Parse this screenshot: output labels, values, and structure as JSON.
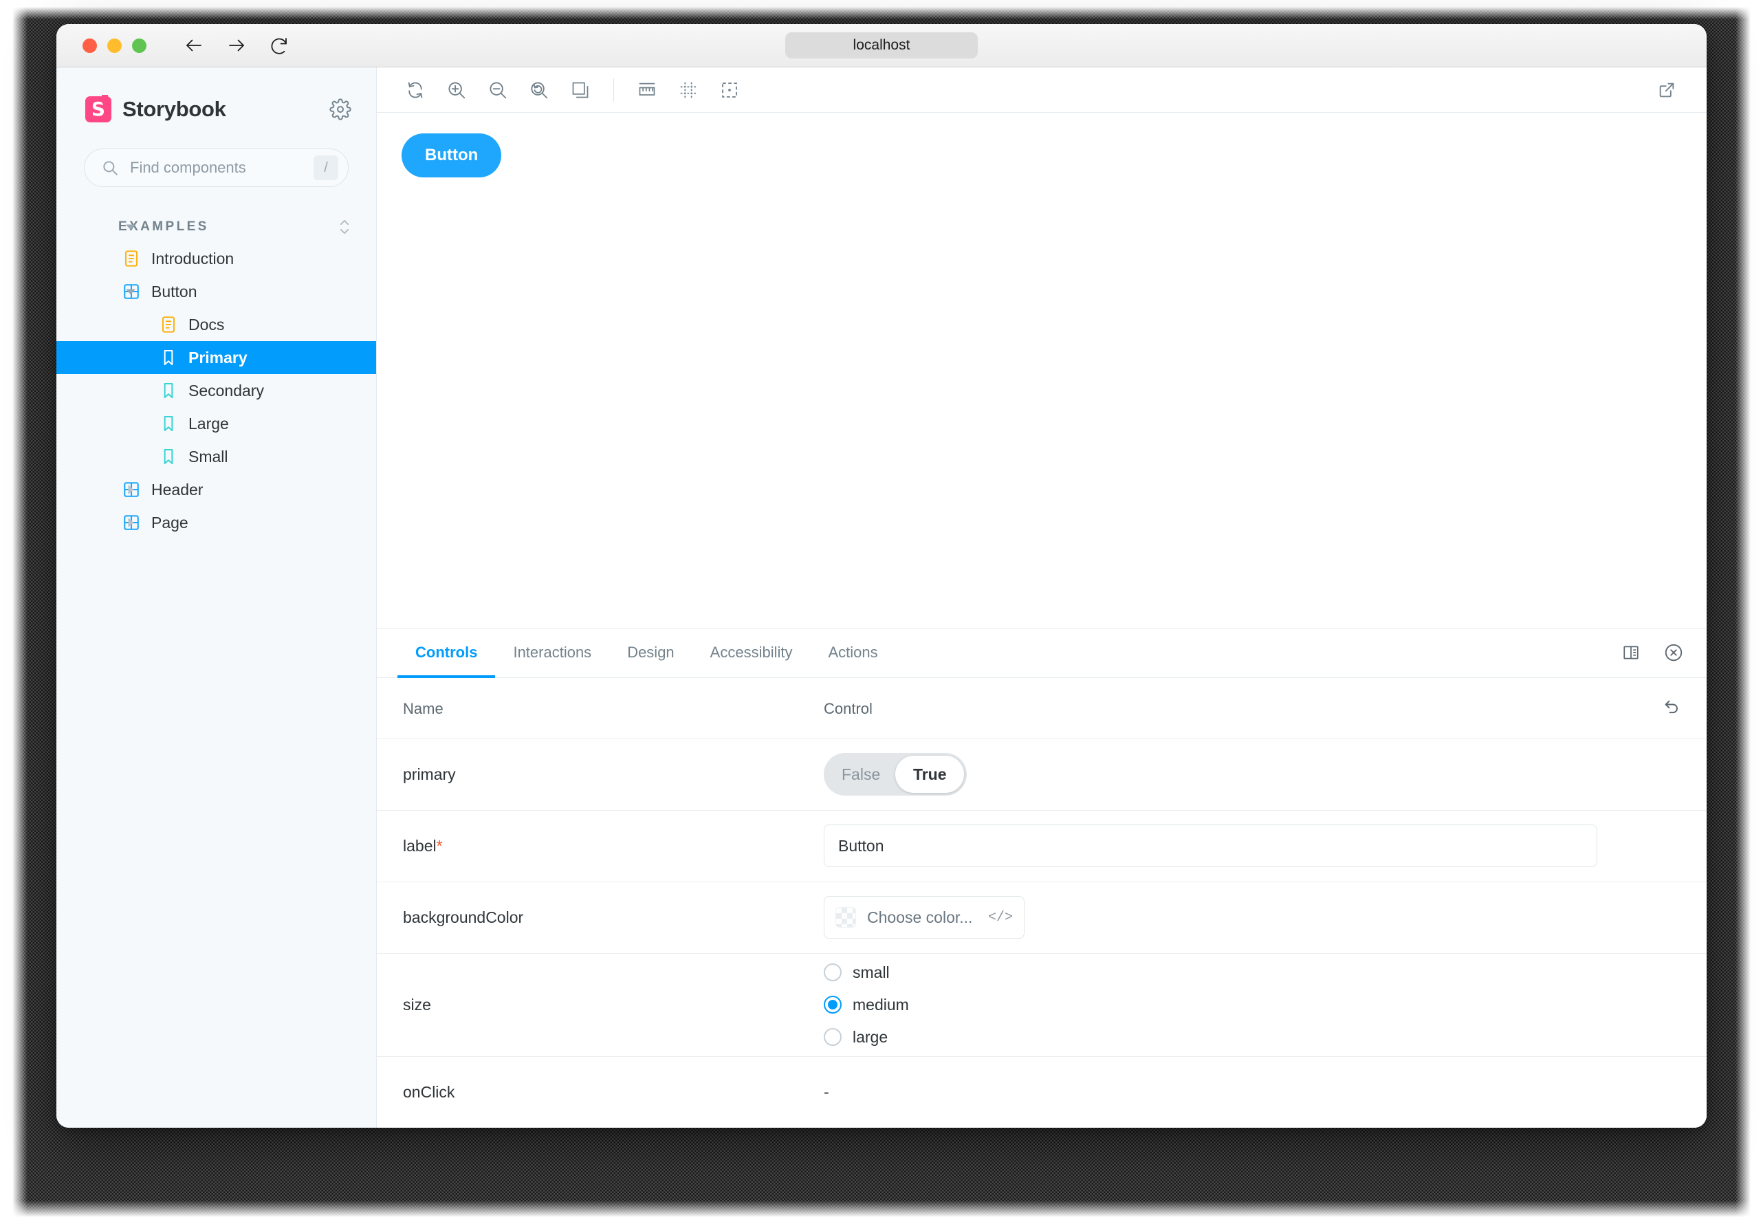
{
  "browser": {
    "url": "localhost",
    "back_icon": "arrow-left-icon",
    "forward_icon": "arrow-right-icon",
    "reload_icon": "reload-icon",
    "traffic_lights": [
      "close",
      "minimize",
      "zoom"
    ]
  },
  "sidebar": {
    "brand": "Storybook",
    "logo_letter": "S",
    "settings_icon": "gear-icon",
    "search": {
      "placeholder": "Find components",
      "shortcut": "/",
      "icon": "search-icon"
    },
    "section": {
      "label": "EXAMPLES",
      "sort_icon": "sort-updown-icon",
      "expanded": true
    },
    "items": [
      {
        "label": "Introduction",
        "icon": "document-icon",
        "depth": 1,
        "selected": false,
        "expandable": false
      },
      {
        "label": "Button",
        "icon": "component-icon",
        "depth": 1,
        "selected": false,
        "expandable": true,
        "expanded": true
      },
      {
        "label": "Docs",
        "icon": "document-icon",
        "depth": 2,
        "selected": false,
        "expandable": false
      },
      {
        "label": "Primary",
        "icon": "story-icon",
        "depth": 2,
        "selected": true,
        "expandable": false
      },
      {
        "label": "Secondary",
        "icon": "story-icon",
        "depth": 2,
        "selected": false,
        "expandable": false
      },
      {
        "label": "Large",
        "icon": "story-icon",
        "depth": 2,
        "selected": false,
        "expandable": false
      },
      {
        "label": "Small",
        "icon": "story-icon",
        "depth": 2,
        "selected": false,
        "expandable": false
      },
      {
        "label": "Header",
        "icon": "component-icon",
        "depth": 1,
        "selected": false,
        "expandable": true,
        "expanded": false
      },
      {
        "label": "Page",
        "icon": "component-icon",
        "depth": 1,
        "selected": false,
        "expandable": true,
        "expanded": false
      }
    ]
  },
  "toolbar": {
    "items": [
      {
        "name": "remount-icon",
        "title": "Remount component"
      },
      {
        "name": "zoom-in-icon",
        "title": "Zoom in"
      },
      {
        "name": "zoom-out-icon",
        "title": "Zoom out"
      },
      {
        "name": "zoom-reset-icon",
        "title": "Reset zoom"
      },
      {
        "name": "backgrounds-icon",
        "title": "Change background"
      },
      {
        "name": "measure-icon",
        "title": "Enable measure"
      },
      {
        "name": "grid-icon",
        "title": "Apply grid"
      },
      {
        "name": "outline-icon",
        "title": "Apply outlines"
      }
    ],
    "open_new_tab_icon": "open-in-new-tab-icon"
  },
  "canvas": {
    "button_label": "Button",
    "button_color": "#1ea7fd"
  },
  "panel": {
    "tabs": [
      {
        "label": "Controls",
        "active": true
      },
      {
        "label": "Interactions",
        "active": false
      },
      {
        "label": "Design",
        "active": false
      },
      {
        "label": "Accessibility",
        "active": false
      },
      {
        "label": "Actions",
        "active": false
      }
    ],
    "tools": [
      {
        "name": "panel-position-icon"
      },
      {
        "name": "close-panel-icon"
      }
    ],
    "table": {
      "headers": {
        "name": "Name",
        "control": "Control"
      },
      "reset_icon": "reset-controls-icon",
      "rows": [
        {
          "name": "primary",
          "required": false,
          "type": "boolean",
          "options": [
            "False",
            "True"
          ],
          "value": "True"
        },
        {
          "name": "label",
          "required": true,
          "required_mark": "*",
          "type": "text",
          "value": "Button"
        },
        {
          "name": "backgroundColor",
          "required": false,
          "type": "color",
          "placeholder": "Choose color...",
          "code_toggle": "</>"
        },
        {
          "name": "size",
          "required": false,
          "type": "radio",
          "options": [
            "small",
            "medium",
            "large"
          ],
          "value": "medium"
        },
        {
          "name": "onClick",
          "required": false,
          "type": "none",
          "value": "-"
        }
      ]
    }
  },
  "colors": {
    "accent": "#029cfd",
    "brand_pink": "#ff4785",
    "story_button": "#1ea7fd",
    "sidebar_bg": "#f5f9fc",
    "required_asterisk": "#f4572a"
  }
}
